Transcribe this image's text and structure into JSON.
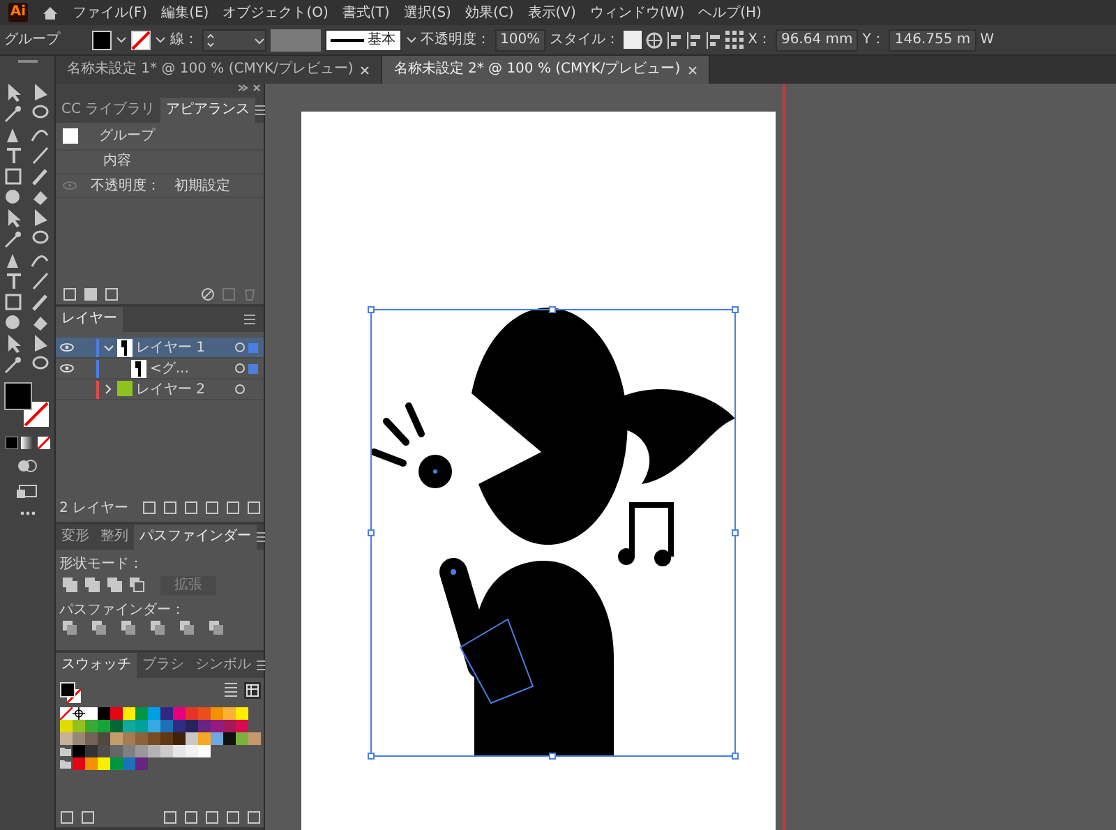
{
  "menu_bar": {
    "logo": "Ai",
    "items": [
      "ファイル(F)",
      "編集(E)",
      "オブジェクト(O)",
      "書式(T)",
      "選択(S)",
      "効果(C)",
      "表示(V)",
      "ウィンドウ(W)",
      "ヘルプ(H)"
    ]
  },
  "control_bar": {
    "selection": "グループ",
    "stroke_label": "線：",
    "stroke_profile": "基本",
    "opacity_label": "不透明度：",
    "opacity": "100%",
    "style_label": "スタイル：",
    "x_label": "X：",
    "x": "96.64 mm",
    "y_label": "Y：",
    "y": "146.755 m",
    "w_label": "W"
  },
  "document_tabs": [
    {
      "title": "名称未設定 1* @ 100 % (CMYK/プレビュー)",
      "selected": false
    },
    {
      "title": "名称未設定 2* @ 100 % (CMYK/プレビュー)",
      "selected": true
    }
  ],
  "appearance_panel": {
    "tabs": [
      {
        "label": "CC ライブラリ",
        "selected": false
      },
      {
        "label": "アピアランス",
        "selected": true
      }
    ],
    "object": "グループ",
    "contents": "内容",
    "opacity_label": "不透明度：",
    "opacity": "初期設定"
  },
  "layers_panel": {
    "tab": "レイヤー",
    "layers": [
      {
        "name": "レイヤー 1",
        "color": "#4a7fe0",
        "visible": true,
        "selected": true,
        "expanded": true,
        "children": [
          {
            "name": "<グ...",
            "visible": true,
            "selected": false
          }
        ]
      },
      {
        "name": "レイヤー 2",
        "color": "#e04a4a",
        "visible": false,
        "selected": false,
        "expanded": false
      }
    ],
    "footer": "2 レイヤー"
  },
  "pathfinder_panel": {
    "tabs": [
      {
        "label": "変形",
        "selected": false
      },
      {
        "label": "整列",
        "selected": false
      },
      {
        "label": "パスファインダー",
        "selected": true
      }
    ],
    "shape_modes_label": "形状モード：",
    "expand_button": "拡張",
    "pathfinders_label": "パスファインダー："
  },
  "swatches_panel": {
    "tabs": [
      {
        "label": "スウォッチ",
        "selected": true
      },
      {
        "label": "ブラシ",
        "selected": false
      },
      {
        "label": "シンボル",
        "selected": false
      }
    ],
    "rows": [
      {
        "group": false,
        "swatches": [
          {
            "kind": "none"
          },
          {
            "kind": "registration"
          },
          {
            "kind": "color",
            "color": "#ffffff"
          },
          {
            "kind": "color",
            "color": "#000000"
          },
          {
            "kind": "color",
            "color": "#e30613"
          },
          {
            "kind": "color",
            "color": "#ffed00"
          },
          {
            "kind": "color",
            "color": "#009640"
          },
          {
            "kind": "color",
            "color": "#009fe3"
          },
          {
            "kind": "color",
            "color": "#312783"
          },
          {
            "kind": "color",
            "color": "#e6007e"
          },
          {
            "kind": "color",
            "color": "#e6332a"
          },
          {
            "kind": "color",
            "color": "#e94e1b"
          },
          {
            "kind": "color",
            "color": "#f39200"
          },
          {
            "kind": "color",
            "color": "#f9b233"
          },
          {
            "kind": "color",
            "color": "#ffed00"
          }
        ]
      },
      {
        "group": false,
        "swatches": [
          {
            "kind": "color",
            "color": "#dedc00"
          },
          {
            "kind": "color",
            "color": "#95c11f"
          },
          {
            "kind": "color",
            "color": "#3aaa35"
          },
          {
            "kind": "color",
            "color": "#13a538"
          },
          {
            "kind": "color",
            "color": "#006633"
          },
          {
            "kind": "color",
            "color": "#13a89e"
          },
          {
            "kind": "color",
            "color": "#00a19a"
          },
          {
            "kind": "color",
            "color": "#36a9e1"
          },
          {
            "kind": "color",
            "color": "#1d71b8"
          },
          {
            "kind": "color",
            "color": "#2d2e83"
          },
          {
            "kind": "color",
            "color": "#29235c"
          },
          {
            "kind": "color",
            "color": "#662483"
          },
          {
            "kind": "color",
            "color": "#951b81"
          },
          {
            "kind": "color",
            "color": "#a3195b"
          },
          {
            "kind": "color",
            "color": "#d60b52"
          }
        ]
      },
      {
        "group": false,
        "swatches": [
          {
            "kind": "color",
            "color": "#c7b299"
          },
          {
            "kind": "color",
            "color": "#998675"
          },
          {
            "kind": "color",
            "color": "#736357"
          },
          {
            "kind": "color",
            "color": "#534741"
          },
          {
            "kind": "color",
            "color": "#c69c6d"
          },
          {
            "kind": "color",
            "color": "#a67c52"
          },
          {
            "kind": "color",
            "color": "#8c6239"
          },
          {
            "kind": "color",
            "color": "#754c24"
          },
          {
            "kind": "color",
            "color": "#603813"
          },
          {
            "kind": "color",
            "color": "#42210b"
          },
          {
            "kind": "color",
            "color": "#c8c8c8"
          },
          {
            "kind": "color",
            "color": "#f7a823"
          },
          {
            "kind": "color",
            "color": "#6fa8dc"
          },
          {
            "kind": "color",
            "color": "#111111"
          },
          {
            "kind": "color",
            "color": "#7bb23c"
          },
          {
            "kind": "color",
            "color": "#c49a6c"
          }
        ]
      },
      {
        "group": true,
        "swatches": [
          {
            "kind": "color",
            "color": "#000000"
          },
          {
            "kind": "color",
            "color": "#333333"
          },
          {
            "kind": "color",
            "color": "#4d4d4d"
          },
          {
            "kind": "color",
            "color": "#666666"
          },
          {
            "kind": "color",
            "color": "#808080"
          },
          {
            "kind": "color",
            "color": "#999999"
          },
          {
            "kind": "color",
            "color": "#b3b3b3"
          },
          {
            "kind": "color",
            "color": "#cccccc"
          },
          {
            "kind": "color",
            "color": "#e6e6e6"
          },
          {
            "kind": "color",
            "color": "#f2f2f2"
          },
          {
            "kind": "color",
            "color": "#ffffff"
          }
        ]
      },
      {
        "group": true,
        "swatches": [
          {
            "kind": "color",
            "color": "#e30613"
          },
          {
            "kind": "color",
            "color": "#f39200"
          },
          {
            "kind": "color",
            "color": "#ffed00"
          },
          {
            "kind": "color",
            "color": "#009640"
          },
          {
            "kind": "color",
            "color": "#1d71b8"
          },
          {
            "kind": "color",
            "color": "#662483"
          }
        ]
      }
    ]
  }
}
